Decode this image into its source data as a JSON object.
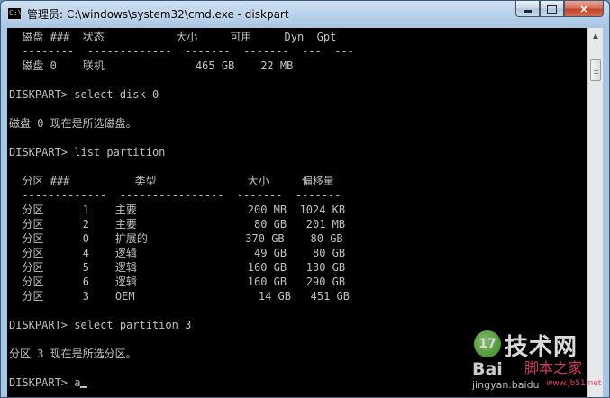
{
  "window": {
    "title": "管理员: C:\\windows\\system32\\cmd.exe - diskpart",
    "icon": "cmd-icon",
    "controls": {
      "minimize": "minimize-icon",
      "maximize": "maximize-icon",
      "close": "×"
    }
  },
  "console": {
    "text_color": "#c0c0c0",
    "background": "#000000",
    "lines": [
      "  磁盘 ###  状态           大小     可用     Dyn  Gpt",
      "  --------  -------------  -------  -------  ---  ---",
      "  磁盘 0    联机              465 GB    22 MB",
      "",
      "DISKPART> select disk 0",
      "",
      "磁盘 0 现在是所选磁盘。",
      "",
      "DISKPART> list partition",
      "",
      "  分区 ###          类型              大小     偏移量",
      "  -------------  ----------------  -------  -------",
      "  分区      1    主要                 200 MB  1024 KB",
      "  分区      2    主要                  80 GB   201 MB",
      "  分区      0    扩展的               370 GB    80 GB",
      "  分区      4    逻辑                  49 GB    80 GB",
      "  分区      5    逻辑                 160 GB   130 GB",
      "  分区      6    逻辑                 160 GB   290 GB",
      "  分区      3    OEM                   14 GB   451 GB",
      "",
      "DISKPART> select partition 3",
      "",
      "分区 3 现在是所选分区。",
      "",
      "DISKPART> a"
    ]
  },
  "watermark": {
    "title": "技术网",
    "logo": "Bai",
    "site": "脚本之家",
    "url_left": "jingyan.baidu",
    "url_right": "www.jb51.net"
  }
}
